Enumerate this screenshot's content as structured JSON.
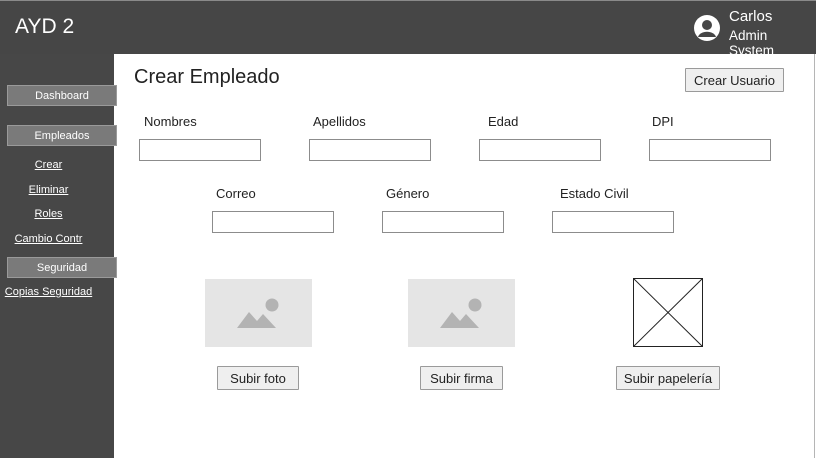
{
  "header": {
    "app_title": "AYD 2",
    "user_name": "Carlos",
    "user_role": "Admin System",
    "avatar_icon": "user-avatar-icon"
  },
  "sidebar": {
    "dashboard": "Dashboard",
    "empleados": "Empleados",
    "crear": "Crear",
    "eliminar": "Eliminar",
    "roles": "Roles",
    "cambio": "Cambio Contr",
    "seguridad": "Seguridad",
    "copias": "Copias Seguridad"
  },
  "main": {
    "title": "Crear Empleado",
    "crear_usuario": "Crear Usuario",
    "fields": {
      "nombres": "Nombres",
      "apellidos": "Apellidos",
      "edad": "Edad",
      "dpi": "DPI",
      "correo": "Correo",
      "genero": "Género",
      "estado_civil": "Estado Civil"
    },
    "uploads": {
      "foto": "Subir foto",
      "firma": "Subir firma",
      "papeleria": "Subir papelería"
    }
  },
  "colors": {
    "topbar": "#464646",
    "sidebar": "#474747",
    "sidebar_button": "#7a7a7a"
  }
}
